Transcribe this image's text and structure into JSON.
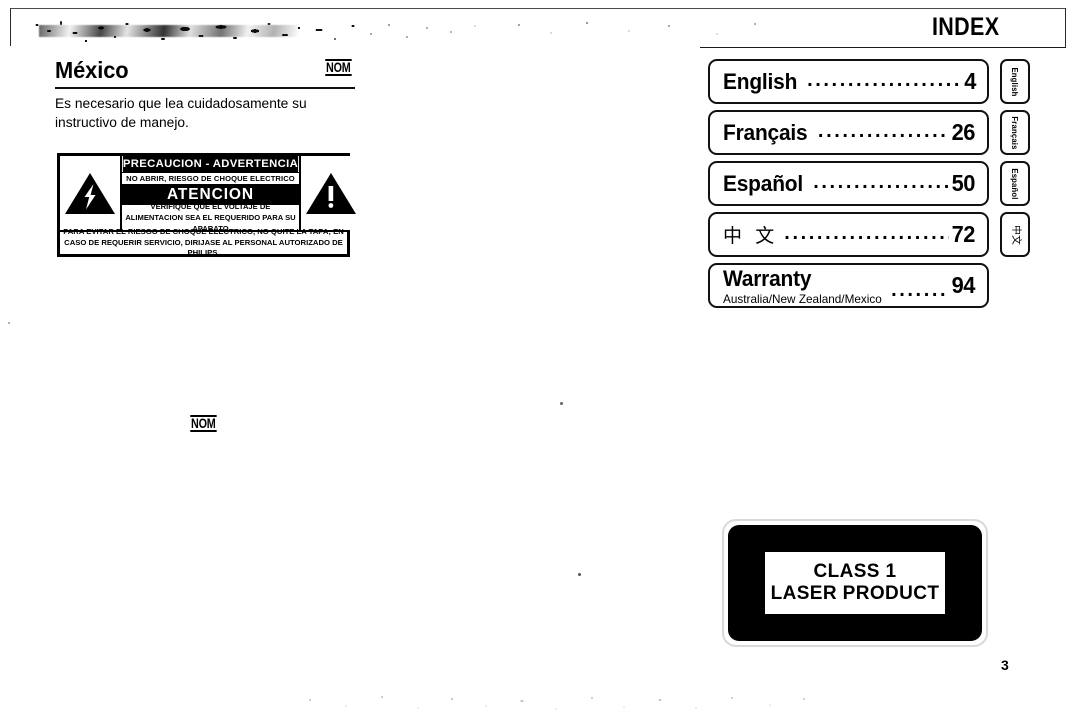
{
  "document": {
    "page_number": "3",
    "index_heading": "INDEX"
  },
  "mexico": {
    "title": "México",
    "nom_badge": "NOM",
    "body": "Es necesario que lea cuidadosamente su instructivo de manejo.",
    "nom_badge_below": "NOM"
  },
  "caution_label": {
    "heading": "PRECAUCION - ADVERTENCIA",
    "subheading": "NO ABRIR, RIESGO DE CHOQUE ELECTRICO",
    "attention": "ATENCION",
    "voltage_notice": "VERIFIQUE QUE EL VOLTAJE DE ALIMENTACION SEA EL REQUERIDO PARA SU APARATO",
    "footer": "PARA EVITAR EL RIESGO DE CHOQUE ELECTRICO, NO QUITE LA TAPA; EN CASO DE REQUERIR SERVICIO, DIRIJASE AL PERSONAL AUTORIZADO DE PHILIPS.",
    "left_icon": "lightning-bolt-triangle-icon",
    "right_icon": "exclamation-triangle-icon"
  },
  "index": {
    "leader_dots": "...................................................",
    "entries": [
      {
        "label": "English",
        "page": "4",
        "subtitle": "",
        "tab": "English",
        "tab_style": "latin"
      },
      {
        "label": "Français",
        "page": "26",
        "subtitle": "",
        "tab": "Français",
        "tab_style": "latin"
      },
      {
        "label": "Español",
        "page": "50",
        "subtitle": "",
        "tab": "Español",
        "tab_style": "latin"
      },
      {
        "label": "中 文",
        "page": "72",
        "subtitle": "",
        "tab": "中文",
        "tab_style": "cjk"
      },
      {
        "label": "Warranty",
        "page": "94",
        "subtitle": "Australia/New Zealand/Mexico",
        "tab": "",
        "tab_style": "none"
      }
    ]
  },
  "laser_notice": {
    "line1": "CLASS 1",
    "line2": "LASER PRODUCT"
  },
  "colors": {
    "ink": "#000000",
    "paper": "#ffffff",
    "rule": "#111111"
  }
}
